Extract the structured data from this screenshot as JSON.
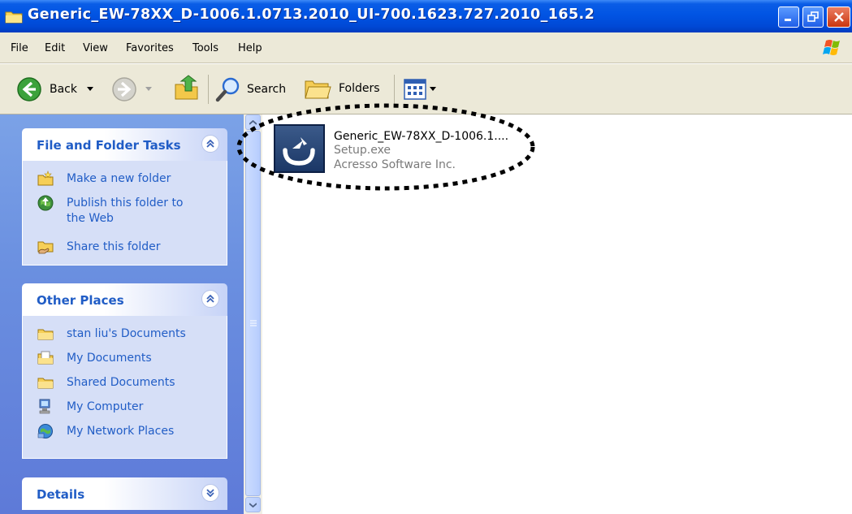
{
  "window": {
    "title": "Generic_EW-78XX_D-1006.1.0713.2010_UI-700.1623.727.2010_165.2",
    "icon": "folder-icon",
    "controls": [
      "minimize-icon",
      "restore-icon",
      "close-icon"
    ]
  },
  "menubar": {
    "items": [
      {
        "label": "File"
      },
      {
        "label": "Edit"
      },
      {
        "label": "View"
      },
      {
        "label": "Favorites"
      },
      {
        "label": "Tools"
      },
      {
        "label": "Help"
      }
    ]
  },
  "toolbar": {
    "back_label": "Back",
    "search_label": "Search",
    "folders_label": "Folders"
  },
  "tasks_panel": {
    "title": "File and Folder Tasks",
    "items": [
      {
        "label": "Make a new folder",
        "icon": "new-folder-icon"
      },
      {
        "label_line1": "Publish this folder to",
        "label_line2": "the Web",
        "icon": "globe-publish-icon"
      },
      {
        "label": "Share this folder",
        "icon": "share-folder-icon"
      }
    ]
  },
  "places_panel": {
    "title": "Other Places",
    "items": [
      {
        "label": "stan liu's Documents",
        "icon": "folder-icon"
      },
      {
        "label": "My Documents",
        "icon": "my-documents-icon"
      },
      {
        "label": "Shared Documents",
        "icon": "folder-icon"
      },
      {
        "label": "My Computer",
        "icon": "computer-icon"
      },
      {
        "label": "My Network Places",
        "icon": "network-icon"
      }
    ]
  },
  "details_panel": {
    "title": "Details"
  },
  "file": {
    "name": "Generic_EW-78XX_D-1006.1....",
    "type": "Setup.exe",
    "company": "Acresso Software Inc."
  },
  "colors": {
    "title_bar": "#0154e3",
    "task_pane": "#6a8fe0",
    "panel_title": "#215dc6",
    "panel_body": "#d6dff7"
  }
}
